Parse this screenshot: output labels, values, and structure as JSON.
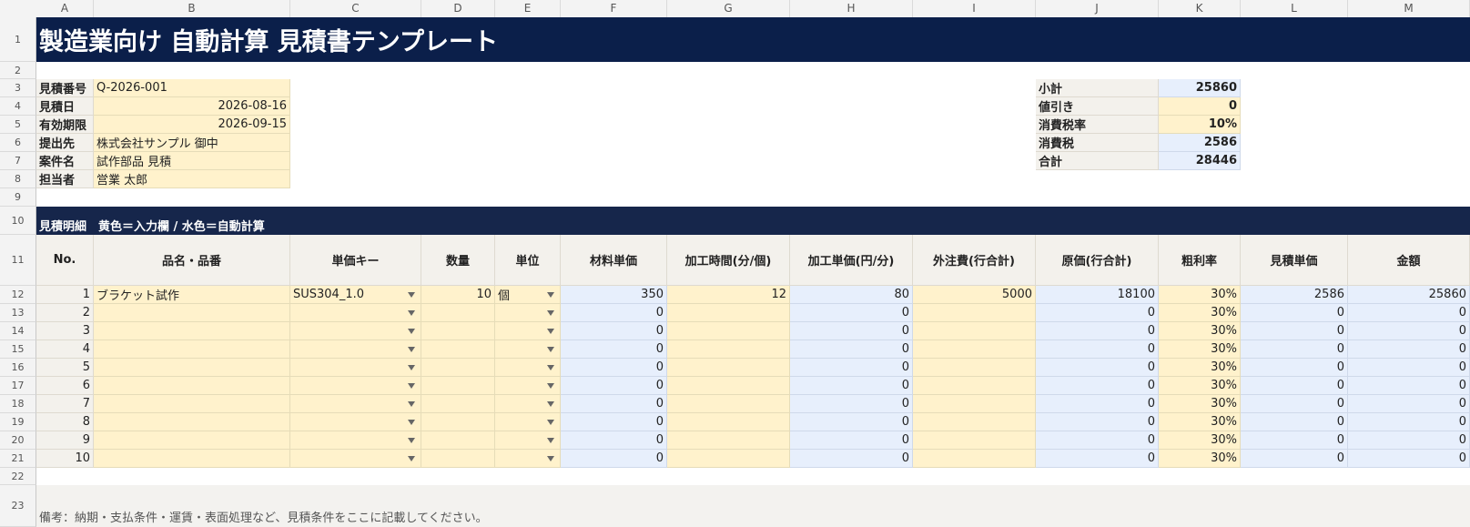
{
  "column_headers": [
    "A",
    "B",
    "C",
    "D",
    "E",
    "F",
    "G",
    "H",
    "I",
    "J",
    "K",
    "L",
    "M"
  ],
  "row_numbers": [
    "1",
    "2",
    "3",
    "4",
    "5",
    "6",
    "7",
    "8",
    "9",
    "10",
    "11",
    "12",
    "13",
    "14",
    "15",
    "16",
    "17",
    "18",
    "19",
    "20",
    "21",
    "22",
    "23"
  ],
  "title": "製造業向け 自動計算 見積書テンプレート",
  "info": [
    {
      "label": "見積番号",
      "value": "Q-2026-001"
    },
    {
      "label": "見積日",
      "value": "2026-08-16"
    },
    {
      "label": "有効期限",
      "value": "2026-09-15"
    },
    {
      "label": "提出先",
      "value": "株式会社サンプル 御中"
    },
    {
      "label": "案件名",
      "value": "試作部品 見積"
    },
    {
      "label": "担当者",
      "value": "営業 太郎"
    }
  ],
  "summary": [
    {
      "label": "小計",
      "value": "25860"
    },
    {
      "label": "値引き",
      "value": "0"
    },
    {
      "label": "消費税率",
      "value": "10%"
    },
    {
      "label": "消費税",
      "value": "2586"
    },
    {
      "label": "合計",
      "value": "28446"
    }
  ],
  "section_header": "見積明細　黄色＝入力欄 / 水色＝自動計算",
  "table": {
    "headers": [
      "No.",
      "品名・品番",
      "単価キー",
      "数量",
      "単位",
      "材料単価",
      "加工時間(分/個)",
      "加工単価(円/分)",
      "外注費(行合計)",
      "原価(行合計)",
      "粗利率",
      "見積単価",
      "金額"
    ],
    "rows": [
      [
        "1",
        "ブラケット試作",
        "SUS304_1.0",
        "10",
        "個",
        "350",
        "12",
        "80",
        "5000",
        "18100",
        "30%",
        "2586",
        "25860"
      ],
      [
        "2",
        "",
        "",
        "",
        "",
        "0",
        "",
        "0",
        "",
        "0",
        "30%",
        "0",
        "0"
      ],
      [
        "3",
        "",
        "",
        "",
        "",
        "0",
        "",
        "0",
        "",
        "0",
        "30%",
        "0",
        "0"
      ],
      [
        "4",
        "",
        "",
        "",
        "",
        "0",
        "",
        "0",
        "",
        "0",
        "30%",
        "0",
        "0"
      ],
      [
        "5",
        "",
        "",
        "",
        "",
        "0",
        "",
        "0",
        "",
        "0",
        "30%",
        "0",
        "0"
      ],
      [
        "6",
        "",
        "",
        "",
        "",
        "0",
        "",
        "0",
        "",
        "0",
        "30%",
        "0",
        "0"
      ],
      [
        "7",
        "",
        "",
        "",
        "",
        "0",
        "",
        "0",
        "",
        "0",
        "30%",
        "0",
        "0"
      ],
      [
        "8",
        "",
        "",
        "",
        "",
        "0",
        "",
        "0",
        "",
        "0",
        "30%",
        "0",
        "0"
      ],
      [
        "9",
        "",
        "",
        "",
        "",
        "0",
        "",
        "0",
        "",
        "0",
        "30%",
        "0",
        "0"
      ],
      [
        "10",
        "",
        "",
        "",
        "",
        "0",
        "",
        "0",
        "",
        "0",
        "30%",
        "0",
        "0"
      ]
    ]
  },
  "memo": "備考：納期・支払条件・運賃・表面処理など、見積条件をここに記載してください。",
  "colors": {
    "title_bg": "#0b1f4a",
    "band_bg": "#16264b",
    "input_yellow": "#fff2cc",
    "calc_blue": "#e7effc",
    "label_bg": "#f3f1ec",
    "dropdown_icon": "chevron-down-icon"
  }
}
